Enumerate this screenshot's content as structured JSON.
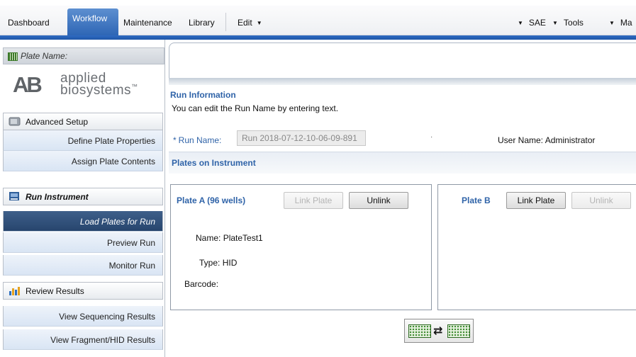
{
  "menubar": {
    "tabs": [
      "Dashboard",
      "Workflow",
      "Maintenance",
      "Library"
    ],
    "active_tab": "Workflow",
    "edit_menu": "Edit",
    "right_menus": [
      "SAE",
      "Tools",
      "Ma"
    ]
  },
  "sidebar": {
    "plate_name_label": "Plate Name:",
    "logo_mark": "AB",
    "logo_line1": "applied",
    "logo_line2": "biosystems",
    "logo_tm": "™",
    "sections": [
      {
        "title": "Advanced Setup",
        "icon": "advanced-setup-icon",
        "items": [
          "Define Plate Properties",
          "Assign Plate Contents"
        ]
      },
      {
        "title": "Run Instrument",
        "icon": "run-instrument-icon",
        "items": [
          "Load Plates for Run",
          "Preview Run",
          "Monitor Run"
        ],
        "selected_item": "Load Plates for Run"
      },
      {
        "title": "Review Results",
        "icon": "bar-chart-icon",
        "items": [
          "View Sequencing Results",
          "View Fragment/HID Results"
        ]
      }
    ]
  },
  "run_information": {
    "title": "Run Information",
    "description": "You can edit the Run Name by entering text.",
    "required_marker": "*",
    "run_name_label": "Run Name:",
    "run_name_value": "Run 2018-07-12-10-06-09-891",
    "user_name_label": "User Name:",
    "user_name_value": "Administrator"
  },
  "plates": {
    "title": "Plates on Instrument",
    "plate_a": {
      "title": "Plate A (96 wells)",
      "link_button": "Link Plate",
      "unlink_button": "Unlink",
      "name_label": "Name:",
      "name_value": "PlateTest1",
      "type_label": "Type:",
      "type_value": "HID",
      "barcode_label": "Barcode:"
    },
    "plate_b": {
      "title": "Plate B",
      "link_button": "Link Plate",
      "unlink_button": "Unlink"
    }
  },
  "colors": {
    "accent_blue": "#2f63a8",
    "menu_blue": "#2e66b5",
    "selected_nav": "#2f4f7a",
    "plate_green": "#3b8a2e"
  }
}
